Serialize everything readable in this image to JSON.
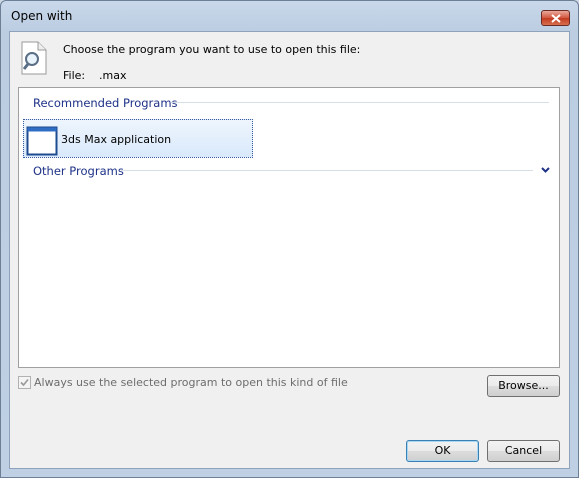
{
  "window": {
    "title": "Open with"
  },
  "dialog": {
    "prompt": "Choose the program you want to use to open this file:",
    "file_label": "File:",
    "file_name": ".max"
  },
  "recommended": {
    "header": "Recommended Programs",
    "items": [
      {
        "label": "3ds Max application",
        "icon": "application-window-icon"
      }
    ]
  },
  "other": {
    "header": "Other Programs"
  },
  "always_use": {
    "label": "Always use the selected program to open this kind of file",
    "checked": true,
    "enabled": false
  },
  "buttons": {
    "browse": "Browse...",
    "ok": "OK",
    "cancel": "Cancel"
  },
  "colors": {
    "group_header": "#1e3287",
    "selection": "#d9e9fb",
    "close_button": "#c23a20"
  }
}
